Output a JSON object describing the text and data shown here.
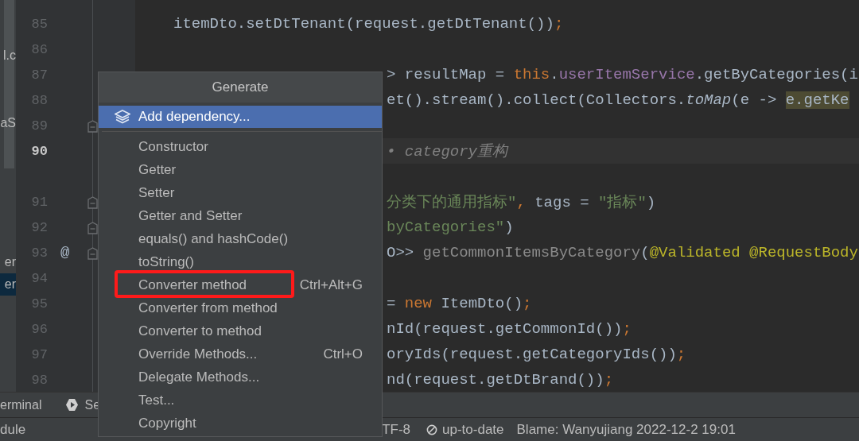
{
  "project_items": [
    {
      "label": "l.c",
      "selected": false
    },
    {
      "label": "aS",
      "selected": false
    },
    {
      "label": "er",
      "selected": false
    },
    {
      "label": "er",
      "selected": true
    }
  ],
  "lines": [
    {
      "number": "85",
      "current": false,
      "fold": false,
      "segments": [
        {
          "text": "itemDto.setDtTenant(request.getDtTenant())",
          "kind": "plain"
        },
        {
          "text": ";",
          "kind": "keyword"
        }
      ]
    },
    {
      "number": "86",
      "current": false,
      "fold": false
    },
    {
      "number": "87",
      "current": false,
      "fold": false,
      "segments": [
        {
          "text": "> resultMap = ",
          "kind": "plain"
        },
        {
          "text": "this",
          "kind": "keyword"
        },
        {
          "text": ".",
          "kind": "plain"
        },
        {
          "text": "userItemService",
          "kind": "field"
        },
        {
          "text": ".getByCategories(i",
          "kind": "plain"
        }
      ]
    },
    {
      "number": "88",
      "current": false,
      "fold": false,
      "segments": [
        {
          "text": "et().stream().collect(Collectors.",
          "kind": "plain"
        },
        {
          "text": "toMap",
          "kind": "static"
        },
        {
          "text": "(e -> ",
          "kind": "plain"
        },
        {
          "text": "e.getKe",
          "kind": "highlight"
        }
      ]
    },
    {
      "number": "89",
      "current": false,
      "fold": true
    },
    {
      "number": "90",
      "current": true,
      "fold": false,
      "segments": [
        {
          "text": "• category重构",
          "kind": "comment"
        }
      ]
    },
    {
      "number": "91",
      "current": false,
      "fold": true,
      "segments": [
        {
          "text": "分类下的通用指标\"",
          "kind": "string"
        },
        {
          "text": ",",
          "kind": "keyword"
        },
        {
          "text": " tags = ",
          "kind": "plain"
        },
        {
          "text": "\"指标\"",
          "kind": "string"
        },
        {
          "text": ")",
          "kind": "plain"
        }
      ]
    },
    {
      "number": "92",
      "current": false,
      "fold": true,
      "segments": [
        {
          "text": "byCategories\"",
          "kind": "string"
        },
        {
          "text": ")",
          "kind": "plain"
        }
      ]
    },
    {
      "number": "93",
      "current": false,
      "fold": true,
      "annotation": "@",
      "segments": [
        {
          "text": "O>> ",
          "kind": "plain"
        },
        {
          "text": "getCommonItemsByCategory",
          "kind": "unused"
        },
        {
          "text": "(",
          "kind": "plain"
        },
        {
          "text": "@Validated @RequestBody",
          "kind": "annotation"
        }
      ]
    },
    {
      "number": "94",
      "current": false,
      "fold": false
    },
    {
      "number": "95",
      "current": false,
      "fold": false,
      "segments": [
        {
          "text": "= ",
          "kind": "plain"
        },
        {
          "text": "new",
          "kind": "keyword"
        },
        {
          "text": " ItemDto()",
          "kind": "plain"
        },
        {
          "text": ";",
          "kind": "keyword"
        }
      ]
    },
    {
      "number": "96",
      "current": false,
      "fold": false,
      "segments": [
        {
          "text": "nId(request.getCommonId())",
          "kind": "plain"
        },
        {
          "text": ";",
          "kind": "keyword"
        }
      ]
    },
    {
      "number": "97",
      "current": false,
      "fold": false,
      "segments": [
        {
          "text": "oryIds(request.getCategoryIds())",
          "kind": "plain"
        },
        {
          "text": ";",
          "kind": "keyword"
        }
      ]
    },
    {
      "number": "98",
      "current": false,
      "fold": false,
      "segments": [
        {
          "text": "nd(request.getDtBrand())",
          "kind": "plain"
        },
        {
          "text": ";",
          "kind": "keyword"
        }
      ]
    }
  ],
  "menu": {
    "title": "Generate",
    "items": [
      {
        "label": "Add dependency...",
        "selected": true,
        "marked": false
      },
      {
        "label": "Constructor",
        "selected": false,
        "marked": false
      },
      {
        "label": "Getter",
        "selected": false,
        "marked": false
      },
      {
        "label": "Setter",
        "selected": false,
        "marked": false
      },
      {
        "label": "Getter and Setter",
        "selected": false,
        "marked": false
      },
      {
        "label": "equals() and hashCode()",
        "selected": false,
        "marked": false
      },
      {
        "label": "toString()",
        "selected": false,
        "marked": false
      },
      {
        "label": "Converter method",
        "shortcut": "Ctrl+Alt+G",
        "selected": false,
        "marked": true
      },
      {
        "label": "Converter from method",
        "selected": false,
        "marked": false
      },
      {
        "label": "Converter to method",
        "selected": false,
        "marked": false
      },
      {
        "label": "Override Methods...",
        "shortcut": "Ctrl+O",
        "selected": false,
        "marked": false
      },
      {
        "label": "Delegate Methods...",
        "selected": false,
        "marked": false
      },
      {
        "label": "Test...",
        "selected": false,
        "marked": false
      },
      {
        "label": "Copyright",
        "selected": false,
        "marked": false
      }
    ]
  },
  "tool_tabs": [
    {
      "label": "erminal"
    },
    {
      "label": "Se"
    }
  ],
  "status_bar": [
    {
      "text": "dule"
    },
    {
      "text": "TF-8"
    },
    {
      "text": "up-to-date"
    },
    {
      "text": "Blame: Wanyujiang 2022-12-2 19:01"
    }
  ]
}
